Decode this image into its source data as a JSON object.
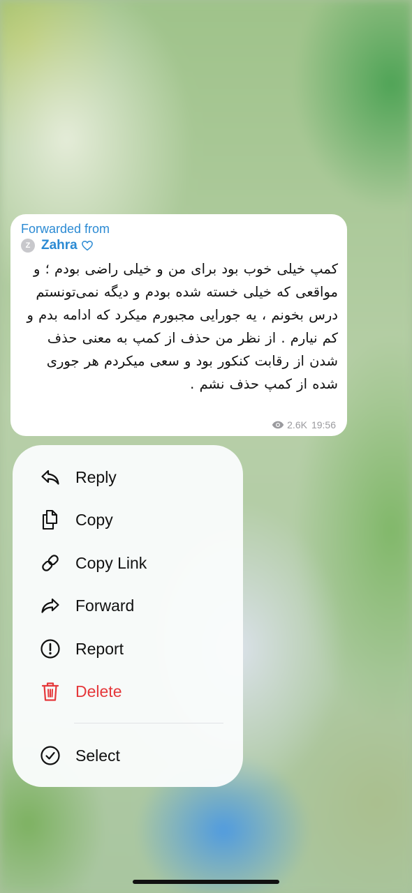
{
  "message": {
    "forwarded_label": "Forwarded from",
    "sender_initial": "Z",
    "sender_name": "Zahra",
    "sender_icon": "heart-outline-icon",
    "text": "کمپ خیلی خوب بود برای من و خیلی راضی بودم ؛ و مواقعی که خیلی خسته شده بودم و دیگه نمی‌تونستم درس بخونم ، یه جورایی مجبورم میکرد که ادامه بدم و کم نیارم . از نظر من حذف از کمپ به معنی حذف شدن از رقابت کنکور بود و سعی میکردم هر جوری شده از کمپ حذف نشم .",
    "views": "2.6K",
    "time": "19:56"
  },
  "menu": {
    "items": [
      {
        "label": "Reply",
        "icon": "reply-icon"
      },
      {
        "label": "Copy",
        "icon": "copy-icon"
      },
      {
        "label": "Copy Link",
        "icon": "link-icon"
      },
      {
        "label": "Forward",
        "icon": "forward-icon"
      },
      {
        "label": "Report",
        "icon": "report-icon"
      },
      {
        "label": "Delete",
        "icon": "trash-icon"
      },
      {
        "label": "Select",
        "icon": "select-check-icon"
      }
    ],
    "danger_color": "#e5383b"
  },
  "colors": {
    "accent": "#2b8ad3",
    "meta": "#9a9a9e"
  }
}
